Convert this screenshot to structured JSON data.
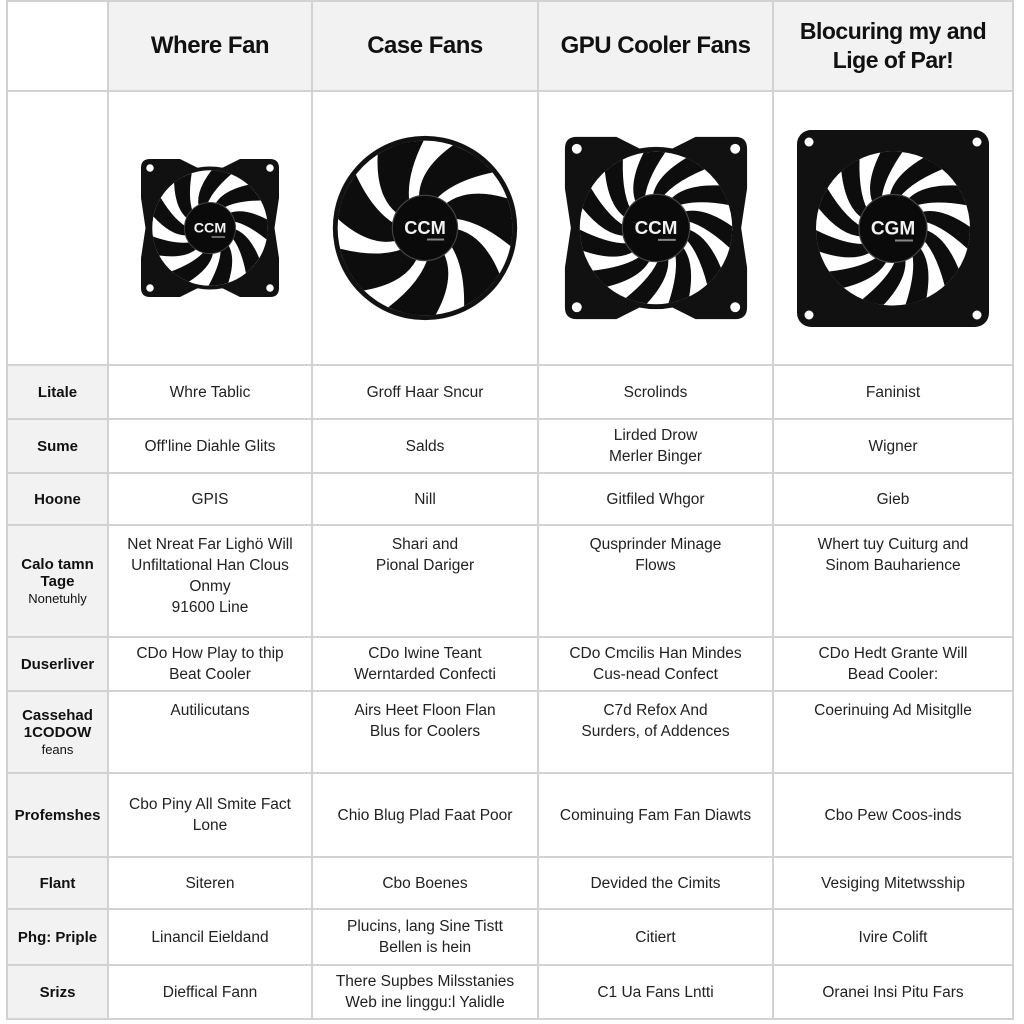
{
  "columns": [
    "Where Fan",
    "Case Fans",
    "GPU Cooler Fans",
    "Blocuring my and Lige of Par!"
  ],
  "fan_images": [
    {
      "icon": "fan-square-frame-icon",
      "label": "CCM"
    },
    {
      "icon": "fan-round-frameless-icon",
      "label": "CCM"
    },
    {
      "icon": "fan-square-frame-icon",
      "label": "CCM"
    },
    {
      "icon": "fan-square-rounded-frame-icon",
      "label": "CGM"
    }
  ],
  "rows": [
    {
      "header": "Litale",
      "sub": "",
      "cells": [
        "Whre Tablic",
        "Groff Haar Sncur",
        "Scrolinds",
        "Faninist"
      ]
    },
    {
      "header": "Sume",
      "sub": "",
      "cells": [
        "Off'line Diahle Glits",
        "Salds",
        "Lirded Drow\nMerler Binger",
        "Wigner"
      ]
    },
    {
      "header": "Hoone",
      "sub": "",
      "cells": [
        "GPIS",
        "Nill",
        "Gitfiled Whgor",
        "Gieb"
      ]
    },
    {
      "header": "Calo tamn\nTage",
      "sub": "Nonetuhly",
      "cells": [
        "Net Nreat Far Lighö Will\nUnfiltational Han Clous\nOnmy\n91600 Line",
        "Shari and\nPional Dariger",
        "Qusprinder Minage\nFlows",
        "Whert tuy Cuiturg and\nSinom Bauharience"
      ]
    },
    {
      "header": "Duserliver",
      "sub": "",
      "cells": [
        "CDo How Play to thip\nBeat Cooler",
        "CDo Iwine Teant\nWerntarded Confecti",
        "CDo Cmcilis Han Mindes\nCus-nead Confect",
        "CDo Hedt Grante Will\nBead Cooler:"
      ]
    },
    {
      "header": "Cassehad\n1CODOW",
      "sub": "feans",
      "cells": [
        "Autilicutans",
        "Airs Heet Floon Flan\nBlus for Coolers",
        "C7d Refox And\nSurders, of Addences",
        "Coerinuing Ad Misitglle"
      ]
    },
    {
      "header": "Profemshes",
      "sub": "",
      "cells": [
        "Cbo Piny All Smite Fact\nLone",
        "Chio Blug Plad Faat Poor",
        "Cominuing Fam Fan Diawts",
        "Cbo Pew Coos-inds"
      ]
    },
    {
      "header": "Flant",
      "sub": "",
      "cells": [
        "Siteren",
        "Cbo Boenes",
        "Devided the Cimits",
        "Vesiging Mitetwsship"
      ]
    },
    {
      "header": "Phg: Priple",
      "sub": "",
      "cells": [
        "Linancil Eieldand",
        "Plucins, lang Sine Tistt\nBellen is hein",
        "Citiert",
        "Ivire Colift"
      ]
    },
    {
      "header": "Srizs",
      "sub": "",
      "cells": [
        "Dieffical Fann",
        "There Supbes Milsstanies\nWeb ine linggu:l Yalidle",
        "C1 Ua Fans Lntti",
        "Oranei Insi Pitu Fars"
      ]
    }
  ]
}
